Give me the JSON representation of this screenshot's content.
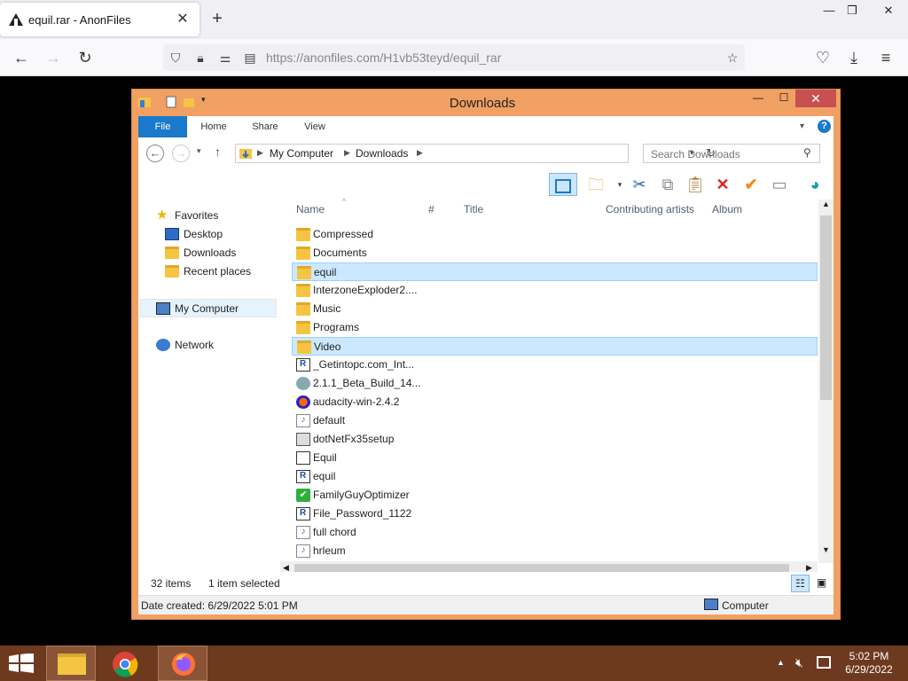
{
  "browser": {
    "tab_title": "equil.rar - AnonFiles",
    "tab_close": "✕",
    "new_tab": "+",
    "url_domain": "https://anonfiles.com",
    "url_path": "/H1vb53teyd/equil_rar"
  },
  "explorer": {
    "title": "Downloads",
    "ribbon_tabs": [
      "File",
      "Home",
      "Share",
      "View"
    ],
    "breadcrumb": [
      "My Computer",
      "Downloads"
    ],
    "search_placeholder": "Search Downloads",
    "nav": {
      "favorites": "Favorites",
      "desktop": "Desktop",
      "downloads": "Downloads",
      "recent": "Recent places",
      "my_computer": "My Computer",
      "network": "Network"
    },
    "columns": [
      "Name",
      "#",
      "Title",
      "Contributing artists",
      "Album"
    ],
    "files": [
      {
        "name": "Compressed",
        "type": "folder"
      },
      {
        "name": "Documents",
        "type": "folder"
      },
      {
        "name": "equil",
        "type": "folder",
        "selected": true
      },
      {
        "name": "InterzoneExploder2....",
        "type": "folder"
      },
      {
        "name": "Music",
        "type": "folder"
      },
      {
        "name": "Programs",
        "type": "folder"
      },
      {
        "name": "Video",
        "type": "folder",
        "hover": true
      },
      {
        "name": "_Getintopc.com_Int...",
        "type": "exe"
      },
      {
        "name": "2.1.1_Beta_Build_14...",
        "type": "globe"
      },
      {
        "name": "audacity-win-2.4.2",
        "type": "audacity"
      },
      {
        "name": "default",
        "type": "audio"
      },
      {
        "name": "dotNetFx35setup",
        "type": "setup"
      },
      {
        "name": "Equil",
        "type": "app"
      },
      {
        "name": "equil",
        "type": "exe"
      },
      {
        "name": "FamilyGuyOptimizer",
        "type": "check"
      },
      {
        "name": "File_Password_1122",
        "type": "exe"
      },
      {
        "name": "full chord",
        "type": "audio"
      },
      {
        "name": "hrleum",
        "type": "audio"
      }
    ],
    "status_items": "32 items",
    "status_selected": "1 item selected",
    "details_date": "Date created: 6/29/2022 5:01 PM",
    "details_location": "Computer"
  },
  "taskbar": {
    "time": "5:02 PM",
    "date": "6/29/2022"
  }
}
